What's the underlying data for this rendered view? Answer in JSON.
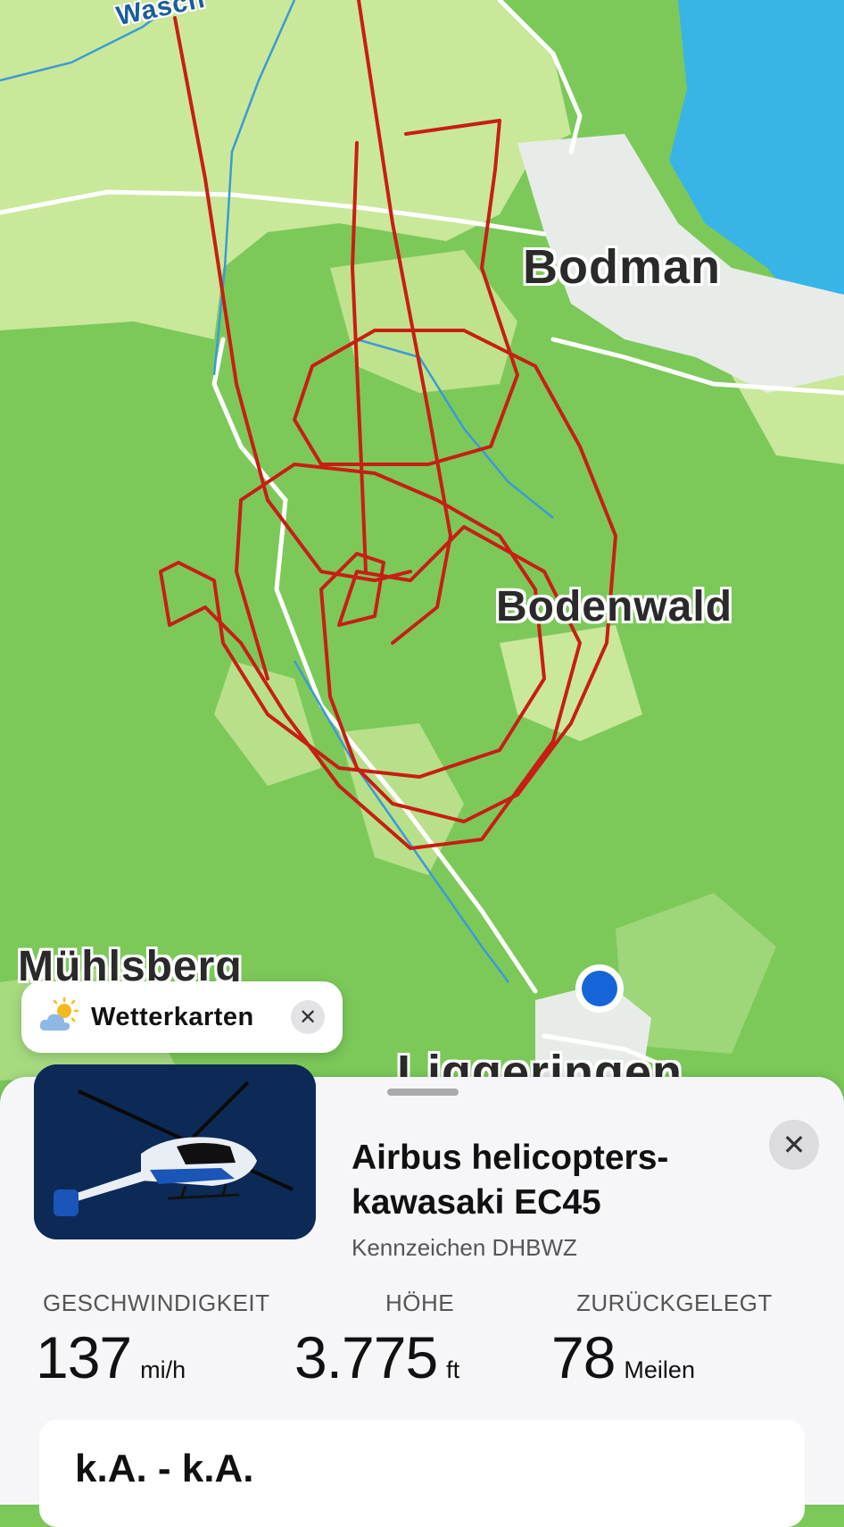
{
  "map": {
    "labels": {
      "bodman": "Bodman",
      "bodenwald": "Bodenwald",
      "muehlsberg": "Mühlsberg",
      "liggeringen": "Liggeringen",
      "wasch": "Wasch"
    },
    "colors": {
      "forest": "#7cc95a",
      "meadow": "#c9e89a",
      "lake": "#38b4e6",
      "track": "#c81e14",
      "location_dot": "#1565d8"
    }
  },
  "weather_chip": {
    "label": "Wetterkarten",
    "icon": "cloud-sun-icon",
    "close_icon": "close-icon"
  },
  "sheet": {
    "title": "Airbus helicopters-kawasaki EC45",
    "registration": "Kennzeichen DHBWZ",
    "stats": {
      "speed": {
        "label": "GESCHWINDIGKEIT",
        "value": "137",
        "unit": "mi/h"
      },
      "altitude": {
        "label": "HÖHE",
        "value": "3.775",
        "unit": "ft"
      },
      "distance": {
        "label": "ZURÜCKGELEGT",
        "value": "78",
        "unit": "Meilen"
      }
    },
    "route": "k.A. - k.A."
  }
}
